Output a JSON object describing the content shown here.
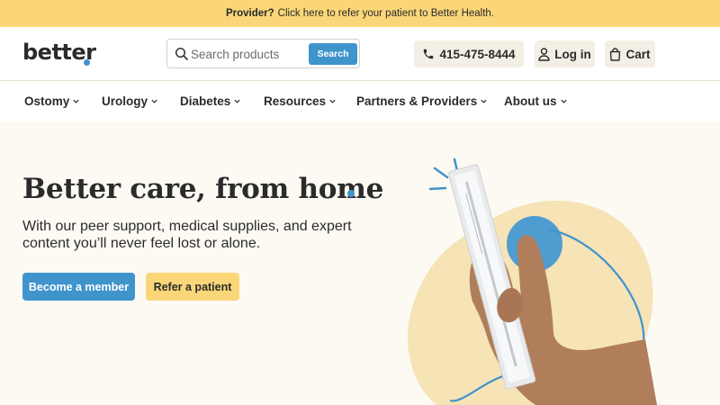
{
  "banner": {
    "bold": "Provider?",
    "text": "Click here to refer your patient to Better Health."
  },
  "header": {
    "logo": "better",
    "search": {
      "placeholder": "Search products",
      "button": "Search"
    },
    "phone": "415-475-8444",
    "login": "Log in",
    "cart": "Cart"
  },
  "nav": {
    "items": [
      {
        "label": "Ostomy"
      },
      {
        "label": "Urology"
      },
      {
        "label": "Diabetes"
      },
      {
        "label": "Resources"
      },
      {
        "label": "Partners & Providers"
      },
      {
        "label": "About us"
      }
    ]
  },
  "hero": {
    "title": "Better care, from home",
    "subtitle": "With our peer support, medical supplies, and expert content you’ll never feel lost or alone.",
    "primary_cta": "Become a member",
    "secondary_cta": "Refer a patient"
  },
  "colors": {
    "brand_blue": "#3f94cc",
    "banner_yellow": "#fad679",
    "page_bg": "#fdfaf3"
  },
  "icons": [
    "search-icon",
    "phone-icon",
    "user-icon",
    "bag-icon",
    "chevron-down-icon"
  ]
}
